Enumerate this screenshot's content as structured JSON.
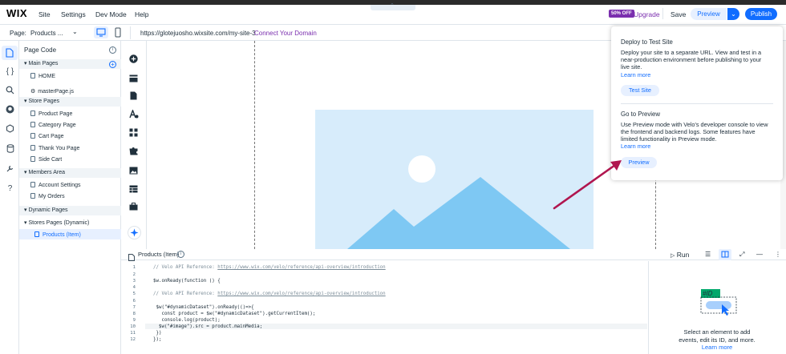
{
  "topbar": {
    "logo": "WIX",
    "menu": [
      "Site",
      "Settings",
      "Dev Mode",
      "Help"
    ],
    "notch_icon": "chevron-up-icon",
    "badge": "50% OFF",
    "upgrade": "Upgrade",
    "save": "Save",
    "preview": "Preview",
    "preview_dropdown": "⌄",
    "publish": "Publish"
  },
  "secondbar": {
    "page_label": "Page:",
    "page_name": "Products ...",
    "page_chevron": "⌄",
    "url": "https://glotejuosho.wixsite.com/my-site-3",
    "connect": "Connect Your Domain"
  },
  "page_code": {
    "title": "Page Code",
    "info": "i",
    "sections": [
      {
        "label": "Main Pages",
        "items": [
          "HOME",
          "masterPage.js"
        ]
      },
      {
        "label": "Store Pages",
        "items": [
          "Product Page",
          "Category Page",
          "Cart Page",
          "Thank You Page",
          "Side Cart"
        ]
      },
      {
        "label": "Members Area",
        "items": [
          "Account Settings",
          "My Orders"
        ]
      },
      {
        "label": "Dynamic Pages",
        "items": []
      }
    ],
    "dynamic_group": "Stores Pages (Dynamic)",
    "dynamic_item": "Products (Item)"
  },
  "popup": {
    "test_title": "Deploy to Test Site",
    "test_desc_1": "Deploy your site to a separate URL. View and test in a",
    "test_desc_2": "near-production environment before publishing to your",
    "test_desc_3": "live site.",
    "test_link": "Learn more",
    "test_button": "Test Site",
    "preview_title": "Go to Preview",
    "preview_desc_1": "Use Preview mode with Velo's developer console to view",
    "preview_desc_2": "the frontend and backend logs. Some features have",
    "preview_desc_3": "limited functionality in Preview mode.",
    "preview_link": "Learn more",
    "preview_button": "Preview"
  },
  "editor": {
    "tab": "Products (Item)",
    "info": "i",
    "run": "Run",
    "lines": [
      {
        "n": "1",
        "text": "  // Velo API Reference: ",
        "link": "https://www.wix.com/velo/reference/api-overview/introduction"
      },
      {
        "n": "2",
        "text": "",
        "link": ""
      },
      {
        "n": "3",
        "text": "  $w.onReady(function () {",
        "link": ""
      },
      {
        "n": "4",
        "text": "",
        "link": ""
      },
      {
        "n": "5",
        "text": "  // Velo API Reference: ",
        "link": "https://www.wix.com/velo/reference/api-overview/introduction"
      },
      {
        "n": "6",
        "text": "",
        "link": ""
      },
      {
        "n": "7",
        "text": "   $w(\"#dynamicDataset\").onReady(()=>{",
        "link": ""
      },
      {
        "n": "8",
        "text": "     const product = $w(\"#dynamicDataset\").getCurrentItem();",
        "link": ""
      },
      {
        "n": "9",
        "text": "     console.log(product);",
        "link": ""
      },
      {
        "n": "10",
        "text": "    $w(\"#image\").src = product.mainMedia;",
        "link": ""
      },
      {
        "n": "11",
        "text": "   })",
        "link": ""
      },
      {
        "n": "12",
        "text": "  });",
        "link": ""
      }
    ],
    "right_tag": "#ID",
    "right_text_1": "Select an element to add",
    "right_text_2": "events, edit its ID, and more.",
    "right_link": "Learn more"
  },
  "colors": {
    "accent": "#116dff",
    "brand": "#7a2eae",
    "arrow": "#b0164f",
    "image_bg": "#d7ecfb",
    "mountain": "#7ec8f3"
  }
}
